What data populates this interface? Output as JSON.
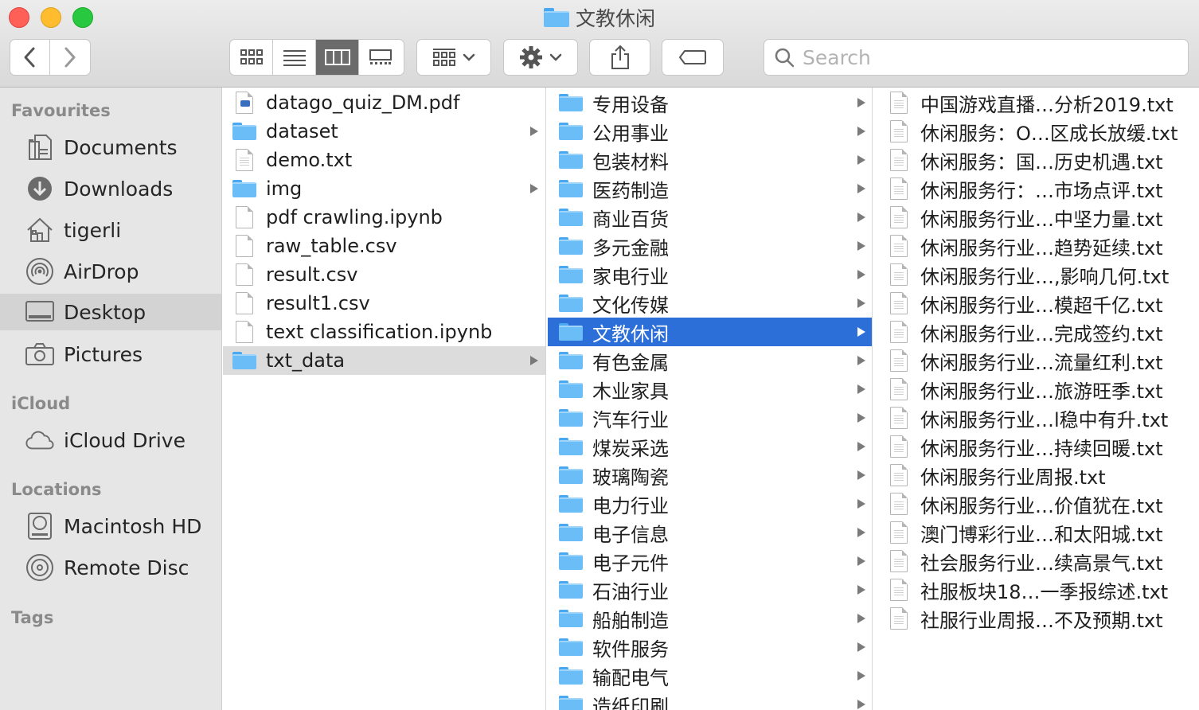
{
  "window": {
    "title": "文教休闲"
  },
  "search": {
    "placeholder": "Search"
  },
  "icons": {
    "back": "chevron-left-icon",
    "forward": "chevron-right-icon",
    "view_icons": "icon-view-icon",
    "view_list": "list-view-icon",
    "view_columns": "column-view-icon",
    "view_gallery": "gallery-view-icon",
    "group": "group-by-icon",
    "action": "gear-icon",
    "share": "share-icon",
    "tags": "tag-icon",
    "search": "search-icon"
  },
  "colors": {
    "selection_blue": "#2c6fd9",
    "folder_blue": "#6bbdf8",
    "selection_grey": "#dcdcdc"
  },
  "sidebar": {
    "favourites_title": "Favourites",
    "favourites": [
      {
        "label": "Documents",
        "icon": "documents-icon"
      },
      {
        "label": "Downloads",
        "icon": "downloads-icon"
      },
      {
        "label": "tigerli",
        "icon": "home-icon"
      },
      {
        "label": "AirDrop",
        "icon": "airdrop-icon"
      },
      {
        "label": "Desktop",
        "icon": "desktop-icon",
        "selected": true
      },
      {
        "label": "Pictures",
        "icon": "camera-icon"
      }
    ],
    "icloud_title": "iCloud",
    "icloud": [
      {
        "label": "iCloud Drive",
        "icon": "cloud-icon"
      }
    ],
    "locations_title": "Locations",
    "locations": [
      {
        "label": "Macintosh HD",
        "icon": "hard-drive-icon"
      },
      {
        "label": "Remote Disc",
        "icon": "disc-icon"
      }
    ],
    "tags_title": "Tags"
  },
  "column1": [
    {
      "name": "datago_quiz_DM.pdf",
      "kind": "pdf"
    },
    {
      "name": "dataset",
      "kind": "folder"
    },
    {
      "name": "demo.txt",
      "kind": "file"
    },
    {
      "name": "img",
      "kind": "folder"
    },
    {
      "name": "pdf crawling.ipynb",
      "kind": "blank"
    },
    {
      "name": "raw_table.csv",
      "kind": "blank"
    },
    {
      "name": "result.csv",
      "kind": "blank"
    },
    {
      "name": "result1.csv",
      "kind": "blank"
    },
    {
      "name": "text classification.ipynb",
      "kind": "blank"
    },
    {
      "name": "txt_data",
      "kind": "folder",
      "selected": true
    }
  ],
  "column2": [
    "专用设备",
    "公用事业",
    "包装材料",
    "医药制造",
    "商业百货",
    "多元金融",
    "家电行业",
    "文化传媒",
    "文教休闲",
    "有色金属",
    "木业家具",
    "汽车行业",
    "煤炭采选",
    "玻璃陶瓷",
    "电力行业",
    "电子信息",
    "电子元件",
    "石油行业",
    "船舶制造",
    "软件服务",
    "输配电气",
    "造纸印刷"
  ],
  "column2_selected": "文教休闲",
  "column3": [
    "中国游戏直播…分析2019.txt",
    "休闲服务：O…区成长放缓.txt",
    "休闲服务：国…历史机遇.txt",
    "休闲服务行：…市场点评.txt",
    "休闲服务行业…中坚力量.txt",
    "休闲服务行业…趋势延续.txt",
    "休闲服务行业…,影响几何.txt",
    "休闲服务行业…模超千亿.txt",
    "休闲服务行业…完成签约.txt",
    "休闲服务行业…流量红利.txt",
    "休闲服务行业…旅游旺季.txt",
    "休闲服务行业…l稳中有升.txt",
    "休闲服务行业…持续回暖.txt",
    "休闲服务行业周报.txt",
    "休闲服务行业…价值犹在.txt",
    "澳门博彩行业…和太阳城.txt",
    "社会服务行业…续高景气.txt",
    "社服板块18…一季报综述.txt",
    "社服行业周报…不及预期.txt"
  ]
}
